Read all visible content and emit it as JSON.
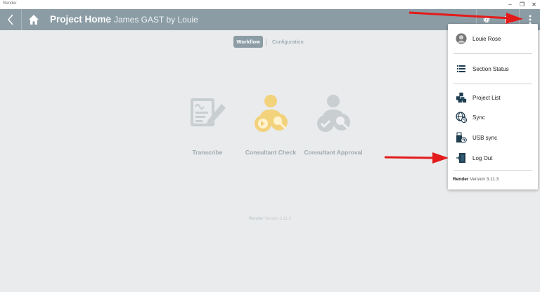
{
  "window": {
    "app_name": "Render",
    "minimize": "–",
    "maximize": "❐",
    "close": "✕"
  },
  "header": {
    "title": "Project Home",
    "separator": "|",
    "subtitle": "James GAST by Louie"
  },
  "tabs": [
    {
      "label": "Workflow",
      "active": true
    },
    {
      "label": "Configuration",
      "active": false
    }
  ],
  "workflow": [
    {
      "label": "Transcribe",
      "icon": "transcribe-icon",
      "color": "#c9ced1"
    },
    {
      "label": "Consultant Check",
      "icon": "consultant-check-icon",
      "color": "#f3d27c"
    },
    {
      "label": "Consultant Approval",
      "icon": "consultant-approval-icon",
      "color": "#c9ced1"
    }
  ],
  "footer": {
    "app": "Render",
    "version": "Version 3.11.3"
  },
  "menu": {
    "user": "Louie Rose",
    "section_status": "Section Status",
    "project_list": "Project List",
    "sync": "Sync",
    "usb_sync": "USB sync",
    "log_out": "Log Out",
    "version_app": "Render",
    "version": "Version 3.11.3"
  },
  "colors": {
    "header": "#8b9ca5",
    "background": "#e9ebed",
    "menu_icon": "#1f3d4f",
    "arrow": "#e31b1b"
  }
}
